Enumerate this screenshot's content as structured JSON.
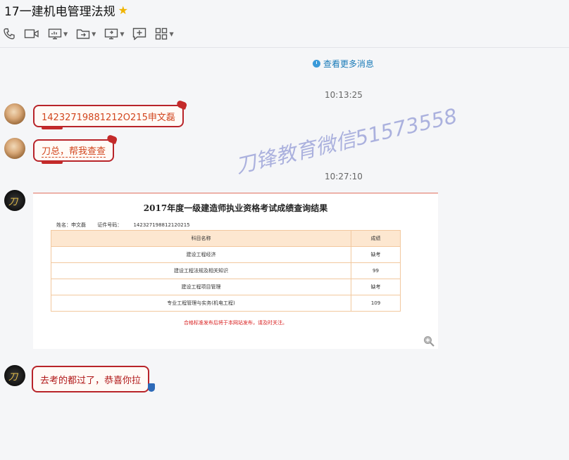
{
  "window": {
    "title": "17一建机电管理法规"
  },
  "toolbar": {
    "icons": [
      "phone-icon",
      "video-call-icon",
      "screen-share-icon",
      "transfer-file-icon",
      "remote-desktop-icon",
      "add-icon",
      "apps-icon"
    ]
  },
  "chat": {
    "more_messages": "查看更多消息",
    "messages": [
      {
        "time": "10:13:25",
        "text": "14232719881212O215申文磊"
      },
      {
        "text": "刀总，帮我查查"
      },
      {
        "time": "10:27:10"
      },
      {
        "card": {
          "title": "2017年度一级建造师执业资格考试成绩查询结果",
          "name_label": "姓名：申文磊",
          "id_label": "证件号码：",
          "id_value": "142327198812120215",
          "columns": [
            "科目名称",
            "成绩"
          ],
          "rows": [
            [
              "建设工程经济",
              "缺考"
            ],
            [
              "建设工程法规及相关知识",
              "99"
            ],
            [
              "建设工程项目管理",
              "缺考"
            ],
            [
              "专业工程管理与实务(机电工程)",
              "109"
            ]
          ],
          "note": "合格标准发布后将于本网站发布，请及时关注。"
        }
      },
      {
        "text": "去考的都过了，恭喜你拉"
      }
    ]
  },
  "watermark": "刀锋教育微信51573558",
  "colors": {
    "bubble_border": "#b8242a",
    "link": "#1a7bb8",
    "card_note": "#d81e1e"
  }
}
